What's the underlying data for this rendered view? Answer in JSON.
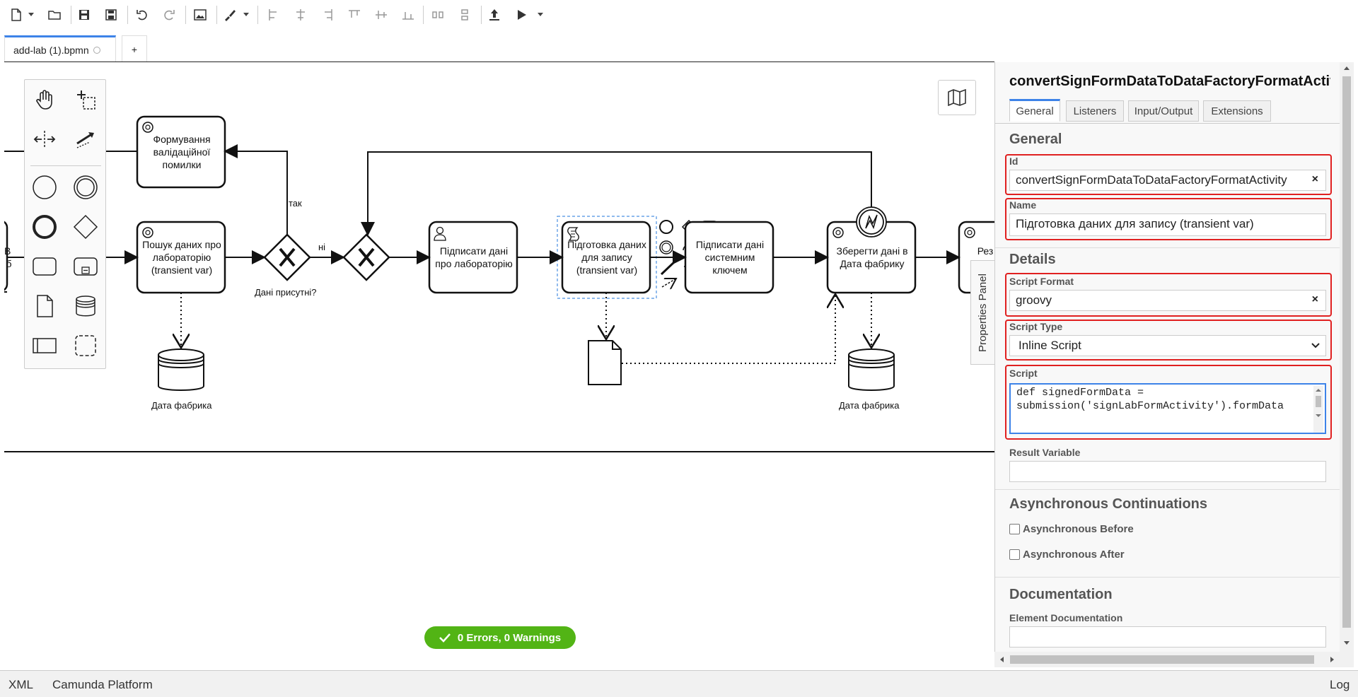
{
  "app": {
    "accent": "#3d83e8",
    "success": "#52b415",
    "error_frame": "#e02020"
  },
  "tabs": {
    "file_label": "add-lab (1).bpmn",
    "new_tab": "+"
  },
  "diagram": {
    "tasks": {
      "validation_error": "Формування валідаційної помилки",
      "search_data": "Пошук даних про лабораторію (transient var)",
      "sign_data": "Підписати дані про лабораторію",
      "prepare_data": "Підготовка даних для запису (transient var)",
      "sign_system_key": "Підписати дані системним ключем",
      "save_data": "Зберегти дані в Дата фабрику",
      "result_partial": "Рез вик",
      "start_partial": "Вста бізн"
    },
    "labels": {
      "yes": "так",
      "no": "ні",
      "gateway": "Дані присутні?",
      "datastore1": "Дата фабрика",
      "datastore2": "Дата фабрика"
    }
  },
  "props_toggle": "Properties Panel",
  "status_pill": "0 Errors, 0 Warnings",
  "panel": {
    "title": "convertSignFormDataToDataFactoryFormatActivity",
    "tabs": [
      "General",
      "Listeners",
      "Input/Output",
      "Extensions"
    ],
    "general_title": "General",
    "id_label": "Id",
    "id_value": "convertSignFormDataToDataFactoryFormatActivity",
    "name_label": "Name",
    "name_value": "Підготовка даних для запису (transient var)",
    "details_title": "Details",
    "script_format_label": "Script Format",
    "script_format_value": "groovy",
    "script_type_label": "Script Type",
    "script_type_value": "Inline Script",
    "script_label": "Script",
    "script_value": "def signedFormData = submission('signLabFormActivity').formData",
    "result_variable_label": "Result Variable",
    "result_variable_value": "",
    "async_title": "Asynchronous Continuations",
    "async_before": "Asynchronous Before",
    "async_after": "Asynchronous After",
    "documentation_title": "Documentation",
    "element_doc_label": "Element Documentation",
    "element_doc_value": "",
    "clear_glyph": "×"
  },
  "statusbar": {
    "xml": "XML",
    "platform": "Camunda Platform",
    "log": "Log"
  }
}
